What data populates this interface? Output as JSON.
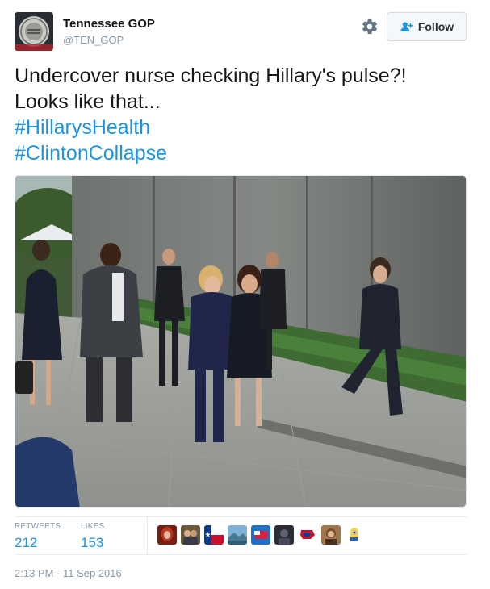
{
  "profile": {
    "display_name": "Tennessee GOP",
    "handle": "@TEN_GOP",
    "avatar_icon": "state-seal-avatar"
  },
  "actions": {
    "settings_icon": "gear-icon",
    "follow_icon": "add-user-icon",
    "follow_label": "Follow"
  },
  "tweet": {
    "lines": [
      "Undercover nurse checking Hillary's pulse?!",
      "Looks like that..."
    ],
    "hashtags": [
      "#HillarysHealth",
      "#ClintonCollapse"
    ],
    "hashtag_color": "#1b95e0"
  },
  "stats": {
    "retweets_label": "RETWEETS",
    "retweets_count": "212",
    "likes_label": "LIKES",
    "likes_count": "153"
  },
  "likers": [
    {
      "icon": "liker-avatar-red-hair"
    },
    {
      "icon": "liker-avatar-couple"
    },
    {
      "icon": "liker-avatar-texas-flag"
    },
    {
      "icon": "liker-avatar-landscape"
    },
    {
      "icon": "liker-avatar-flag-blue"
    },
    {
      "icon": "liker-avatar-dark"
    },
    {
      "icon": "liker-avatar-trump-2016",
      "text": "TRUMP 2016"
    },
    {
      "icon": "liker-avatar-portrait"
    },
    {
      "icon": "liker-avatar-minion"
    }
  ],
  "timestamp": "2:13 PM - 11 Sep 2016",
  "colors": {
    "link_blue": "#1b95e0",
    "meta_gray": "#8899a6",
    "text_dark": "#14171a"
  }
}
